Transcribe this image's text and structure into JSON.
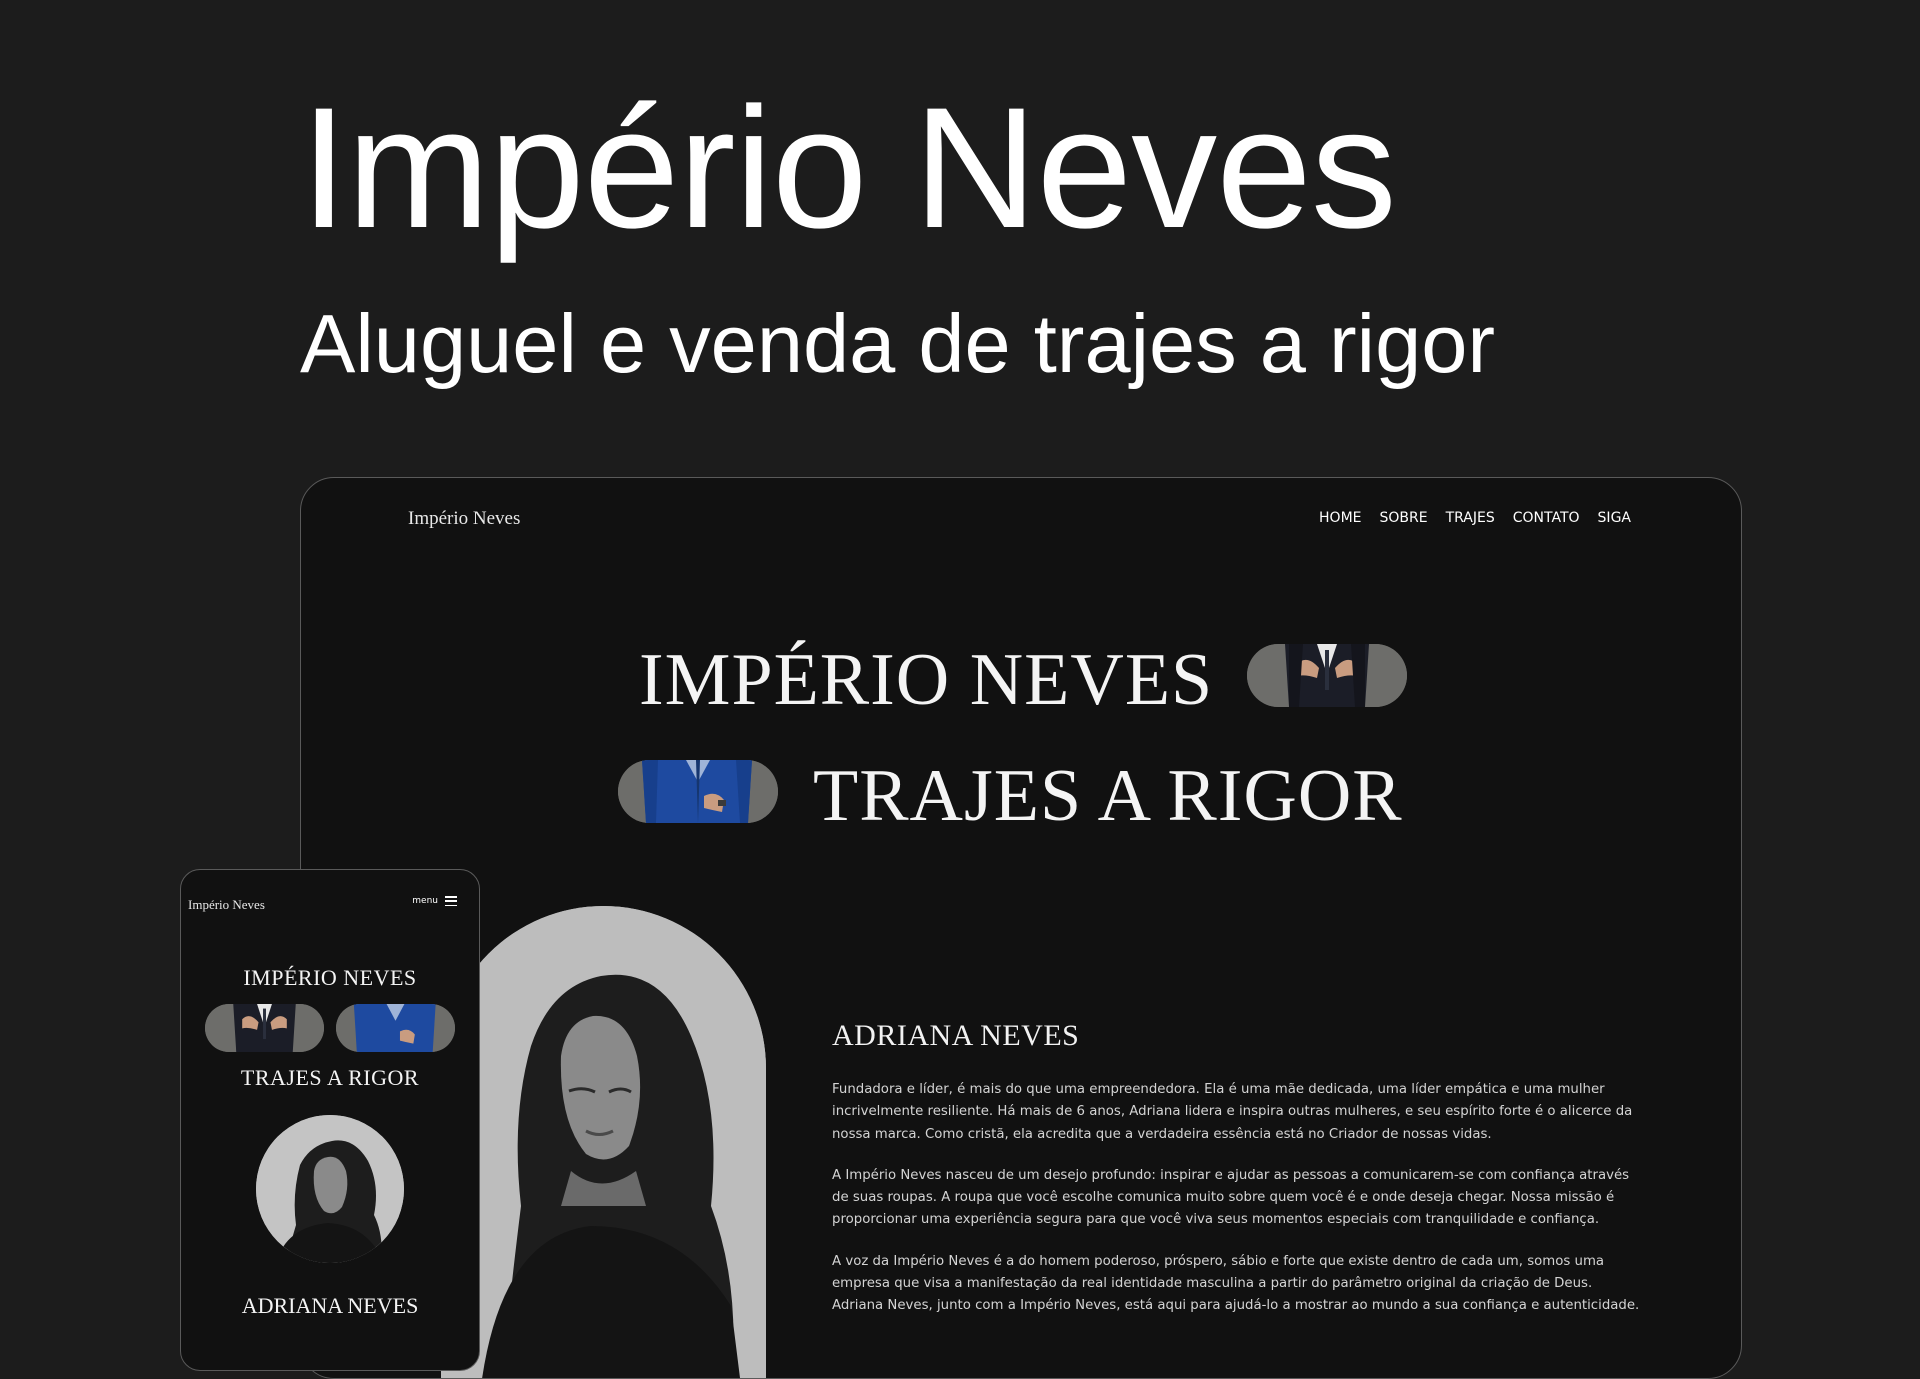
{
  "page": {
    "title": "Império Neves",
    "subtitle": "Aluguel e venda de trajes a rigor"
  },
  "desktop": {
    "logo": "Império Neves",
    "nav": [
      "HOME",
      "SOBRE",
      "TRAJES",
      "CONTATO",
      "SIGA"
    ],
    "hero_line1": "IMPÉRIO NEVES",
    "hero_line2": "TRAJES A RIGOR",
    "about_heading": "ADRIANA NEVES",
    "about_paragraphs": [
      "Fundadora e líder, é mais do que uma empreendedora. Ela é uma mãe dedicada, uma líder empática e uma mulher incrivelmente resiliente. Há mais de 6 anos, Adriana lidera e inspira outras mulheres, e seu espírito forte é o alicerce da nossa marca. Como cristã, ela acredita que a verdadeira essência está no Criador de nossas vidas.",
      "A Império Neves nasceu de um desejo profundo: inspirar e ajudar as pessoas a comunicarem-se com confiança através de suas roupas. A roupa que você escolhe comunica muito sobre quem você é e onde deseja chegar. Nossa missão é proporcionar uma experiência segura para que você viva seus momentos especiais com tranquilidade e confiança.",
      "A voz da Império Neves é a do homem poderoso, próspero, sábio e forte que existe dentro de cada um, somos uma empresa que visa a manifestação da real identidade masculina a partir do parâmetro original da criação de Deus. Adriana Neves, junto com a Império Neves, está aqui para ajudá-lo a mostrar ao mundo a sua confiança e autenticidade."
    ]
  },
  "mobile": {
    "logo": "Império Neves",
    "menu_label": "menu",
    "hero_line1": "IMPÉRIO NEVES",
    "hero_line2": "TRAJES A RIGOR",
    "about_heading": "ADRIANA NEVES"
  },
  "colors": {
    "page_background": "#1c1c1c",
    "site_background": "#111111",
    "frame_border": "#5a5a5a",
    "pill_background": "#6d6d6a",
    "suit_dark": "#1b1d27",
    "suit_blue": "#1e4aa0",
    "portrait_background": "#bdbdbd"
  },
  "icons": [
    "hamburger-menu-icon"
  ]
}
